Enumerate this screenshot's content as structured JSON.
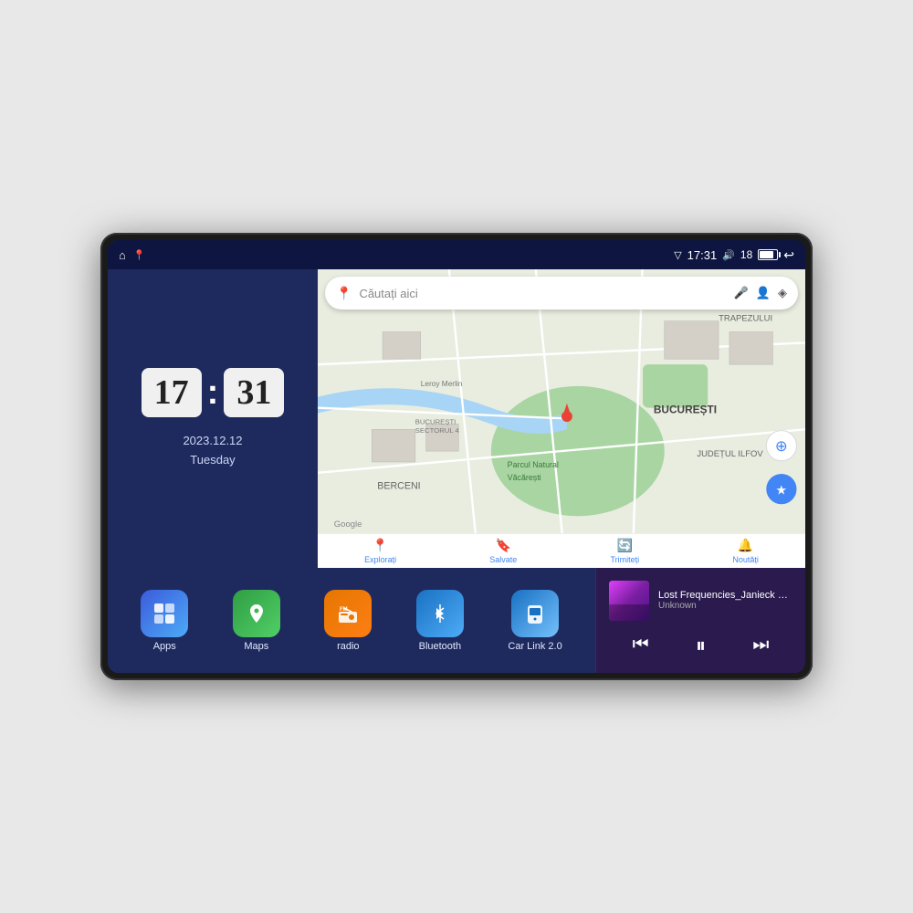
{
  "device": {
    "status_bar": {
      "nav_icon": "⌂",
      "maps_icon": "📍",
      "signal_icon": "▽",
      "time": "17:31",
      "volume_icon": "🔊",
      "volume_level": "18",
      "battery_icon": "🔋",
      "back_icon": "↩"
    },
    "clock": {
      "hours": "17",
      "minutes": "31",
      "date": "2023.12.12",
      "day": "Tuesday"
    },
    "map": {
      "search_placeholder": "Căutați aici",
      "nav_items": [
        {
          "label": "Explorați",
          "icon": "📍",
          "active": true
        },
        {
          "label": "Salvate",
          "icon": "🔖",
          "active": false
        },
        {
          "label": "Trimiteți",
          "icon": "🔄",
          "active": false
        },
        {
          "label": "Noutăți",
          "icon": "🔔",
          "active": false
        }
      ],
      "location_labels": [
        "BUCUREȘTI",
        "JUDEȚUL ILFOV",
        "TRAPEZULUI",
        "BERCENI",
        "PARCUL NATURAL VĂCĂREȘTI"
      ]
    },
    "apps": [
      {
        "id": "apps",
        "label": "Apps",
        "icon": "⊞",
        "css_class": "app-apps"
      },
      {
        "id": "maps",
        "label": "Maps",
        "icon": "🗺",
        "css_class": "app-maps"
      },
      {
        "id": "radio",
        "label": "radio",
        "icon": "📻",
        "css_class": "app-radio"
      },
      {
        "id": "bluetooth",
        "label": "Bluetooth",
        "icon": "⦿",
        "css_class": "app-bluetooth"
      },
      {
        "id": "carlink",
        "label": "Car Link 2.0",
        "icon": "📱",
        "css_class": "app-carlink"
      }
    ],
    "media": {
      "title": "Lost Frequencies_Janieck Devy-...",
      "artist": "Unknown",
      "prev_icon": "⏮",
      "play_icon": "⏸",
      "next_icon": "⏭"
    }
  }
}
